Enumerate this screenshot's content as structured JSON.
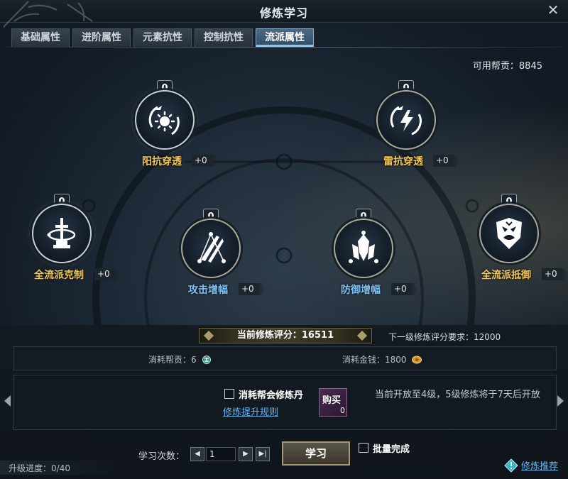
{
  "window": {
    "title": "修炼学习",
    "close_label": "✕"
  },
  "tabs": [
    {
      "label": "基础属性",
      "active": false
    },
    {
      "label": "进阶属性",
      "active": false
    },
    {
      "label": "元素抗性",
      "active": false
    },
    {
      "label": "控制抗性",
      "active": false
    },
    {
      "label": "流派属性",
      "active": true
    }
  ],
  "contribution": {
    "label": "可用帮贡：",
    "value": "8845"
  },
  "nodes": {
    "yang": {
      "level": "0",
      "name": "阳抗穿透",
      "bonus": "+0",
      "icon": "sun-slash-icon"
    },
    "lei": {
      "level": "0",
      "name": "雷抗穿透",
      "bonus": "+0",
      "icon": "lightning-slash-icon"
    },
    "kezhi": {
      "level": "0",
      "name": "全流派克制",
      "bonus": "+0",
      "icon": "sword-orbit-icon"
    },
    "gongji": {
      "level": "0",
      "name": "攻击增幅",
      "bonus": "+0",
      "icon": "crossed-blades-icon"
    },
    "fangyu": {
      "level": "0",
      "name": "防御增幅",
      "bonus": "+0",
      "icon": "armor-crest-icon"
    },
    "diyu": {
      "level": "0",
      "name": "全流派抵御",
      "bonus": "+0",
      "icon": "shield-face-icon"
    }
  },
  "score": {
    "label": "当前修炼评分：",
    "value": "16511"
  },
  "next_requirement": {
    "label": "下一级修炼评分要求：",
    "value": "12000"
  },
  "costs": {
    "contribution": {
      "label": "消耗帮贡：",
      "value": "6",
      "icon": "guild-token-icon"
    },
    "money": {
      "label": "消耗金钱：",
      "value": "1800",
      "icon": "gold-coin-icon"
    }
  },
  "pill": {
    "checkbox_label": "消耗帮会修炼丹",
    "rules_link": "修炼提升规则",
    "item_label": "购买",
    "item_count": "0"
  },
  "notice": {
    "text": "当前开放至4级，5级修炼将于7天后开放"
  },
  "study": {
    "label": "学习次数：",
    "quantity": "1",
    "button": "学习",
    "batch_label": "批量完成"
  },
  "progress": {
    "label": "升级进度：",
    "value": "0/40"
  },
  "recommend": {
    "label": "修炼推荐"
  },
  "colors": {
    "gold": "#f1c75a",
    "blue": "#7fc2f4",
    "tab_active": "#2f4d66"
  }
}
